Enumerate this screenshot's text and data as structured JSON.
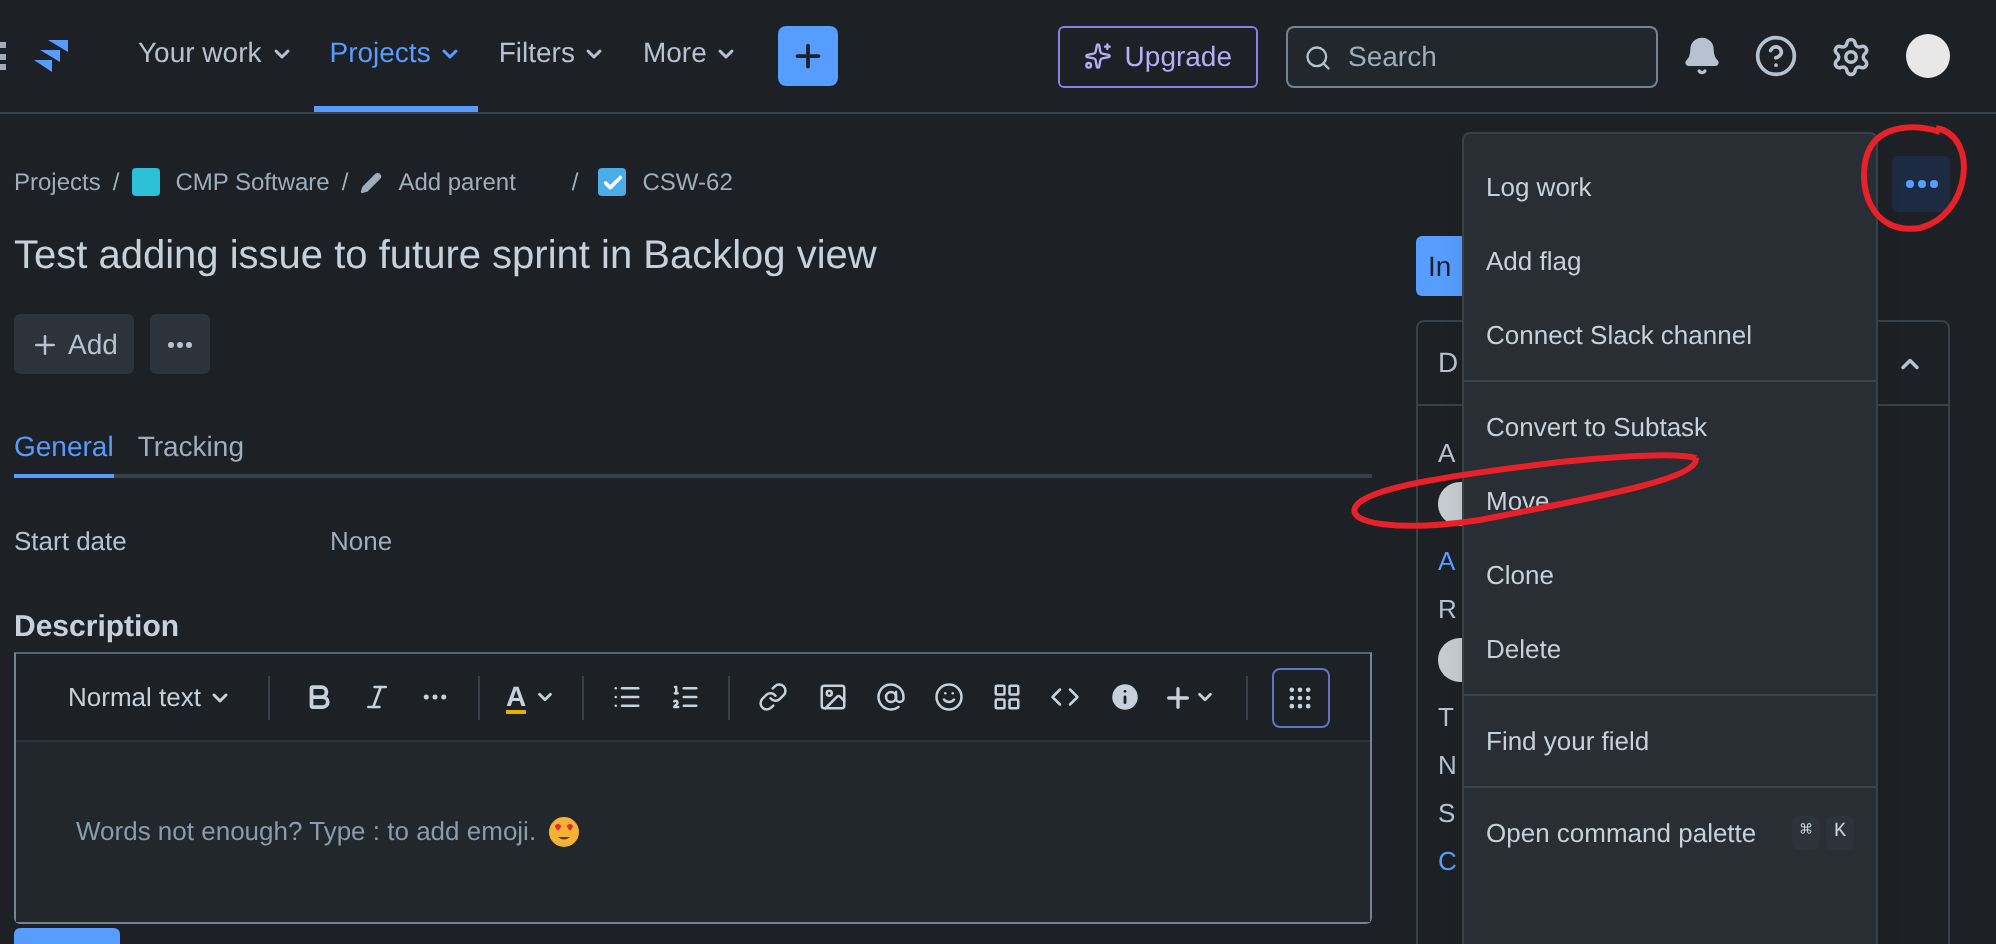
{
  "nav": {
    "items": [
      {
        "label": "Your work",
        "selected": false
      },
      {
        "label": "Projects",
        "selected": true
      },
      {
        "label": "Filters",
        "selected": false
      },
      {
        "label": "More",
        "selected": false
      }
    ],
    "upgrade": "Upgrade",
    "search": {
      "placeholder": "Search"
    }
  },
  "breadcrumbs": [
    {
      "kind": "text",
      "label": "Projects"
    },
    {
      "kind": "separator",
      "label": "/"
    },
    {
      "kind": "project",
      "label": "CMP Software"
    },
    {
      "kind": "separator",
      "label": "/"
    },
    {
      "kind": "parent",
      "label": "Add parent"
    },
    {
      "kind": "separator",
      "label": "/"
    },
    {
      "kind": "issue",
      "label": "CSW-62"
    }
  ],
  "title": "Test adding issue to future sprint in Backlog view",
  "add_button": "Add",
  "tabs": [
    {
      "label": "General",
      "selected": true
    },
    {
      "label": "Tracking",
      "selected": false
    }
  ],
  "fields": [
    {
      "label": "Start date",
      "value": "None"
    }
  ],
  "description": {
    "heading": "Description",
    "text_style": "Normal text",
    "text_color_button": "A",
    "placeholder": "Words not enough? Type : to add emoji."
  },
  "side_panel": {
    "button": "In",
    "card_header": "D",
    "labels": [
      {
        "kind": "label",
        "text": "A"
      },
      {
        "kind": "avatar"
      },
      {
        "kind": "link",
        "text": "A"
      },
      {
        "kind": "label",
        "text": "R"
      },
      {
        "kind": "avatar"
      },
      {
        "kind": "label",
        "text": "T"
      },
      {
        "kind": "label",
        "text": "N"
      },
      {
        "kind": "label",
        "text": "S"
      },
      {
        "kind": "link",
        "text": "C"
      }
    ]
  },
  "menu": {
    "groups": [
      [
        {
          "label": "Log work"
        },
        {
          "label": "Add flag"
        },
        {
          "label": "Connect Slack channel"
        }
      ],
      [
        {
          "label": "Convert to Subtask"
        },
        {
          "label": "Move"
        },
        {
          "label": "Clone"
        },
        {
          "label": "Delete"
        }
      ],
      [
        {
          "label": "Find your field"
        }
      ],
      [
        {
          "label": "Open command palette",
          "keys": [
            "⌘",
            "K"
          ]
        }
      ]
    ]
  }
}
